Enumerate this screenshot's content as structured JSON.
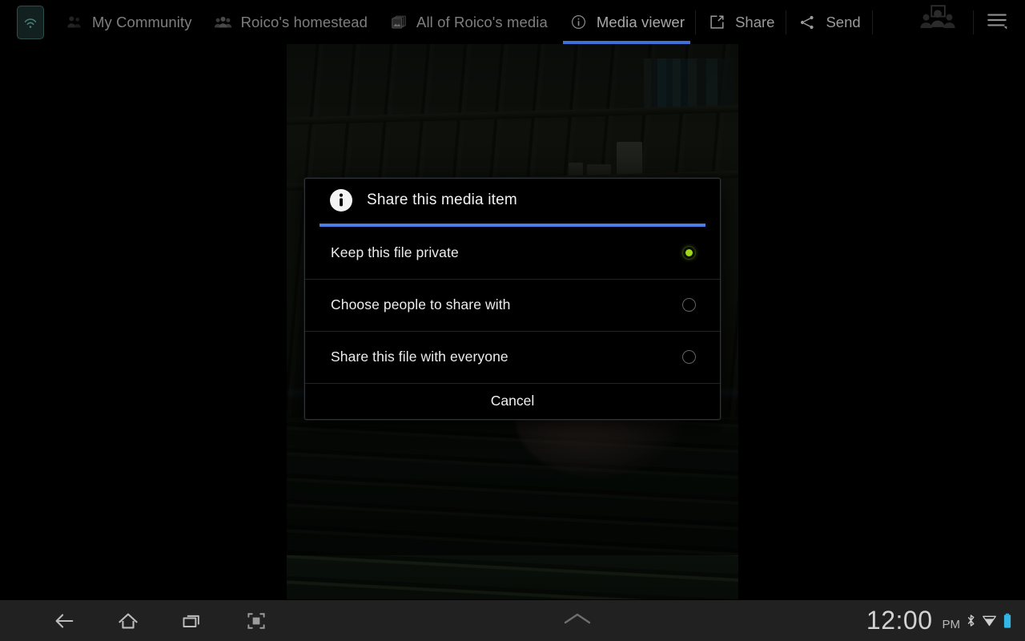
{
  "app": {
    "icon_name": "broadcast-app-icon"
  },
  "topbar": {
    "tabs": [
      {
        "label": "My Community",
        "icon": "community-icon",
        "active": false
      },
      {
        "label": "Roico's homestead",
        "icon": "people-icon",
        "active": false
      },
      {
        "label": "All of Roico's media",
        "icon": "media-stack-icon",
        "active": false
      },
      {
        "label": "Media viewer",
        "icon": "info-circle-icon",
        "active": true
      }
    ],
    "actions": [
      {
        "label": "Share",
        "icon": "share-box-arrow-icon"
      },
      {
        "label": "Send",
        "icon": "share-nodes-icon"
      }
    ],
    "people_button": "people-group-icon",
    "overflow_button": "hamburger-menu-icon",
    "active_tab_underline_color": "#3f6fd8"
  },
  "dialog": {
    "title": "Share this media item",
    "icon": "info-circle-filled-icon",
    "accent_color": "#4a7ee8",
    "selected_index": 0,
    "options": [
      {
        "label": "Keep this file private",
        "selected": true
      },
      {
        "label": "Choose people to share with",
        "selected": false
      },
      {
        "label": "Share this file with everyone",
        "selected": false
      }
    ],
    "cancel_label": "Cancel",
    "selected_radio_color": "#9fd71b"
  },
  "media": {
    "description": "Dim photo of a wooden shed interior with shelves and a hand over a table"
  },
  "systembar": {
    "buttons": [
      {
        "name": "back-button",
        "icon": "arrow-left-icon"
      },
      {
        "name": "home-button",
        "icon": "home-icon"
      },
      {
        "name": "recent-apps-button",
        "icon": "recent-apps-icon"
      },
      {
        "name": "screenshot-button",
        "icon": "crop-frame-icon"
      }
    ],
    "expand_icon": "chevron-up-icon",
    "time": "12:00",
    "meridiem": "PM",
    "status_icons": [
      "bluetooth-icon",
      "wifi-icon",
      "battery-icon"
    ],
    "battery_color": "#33b5e5"
  }
}
